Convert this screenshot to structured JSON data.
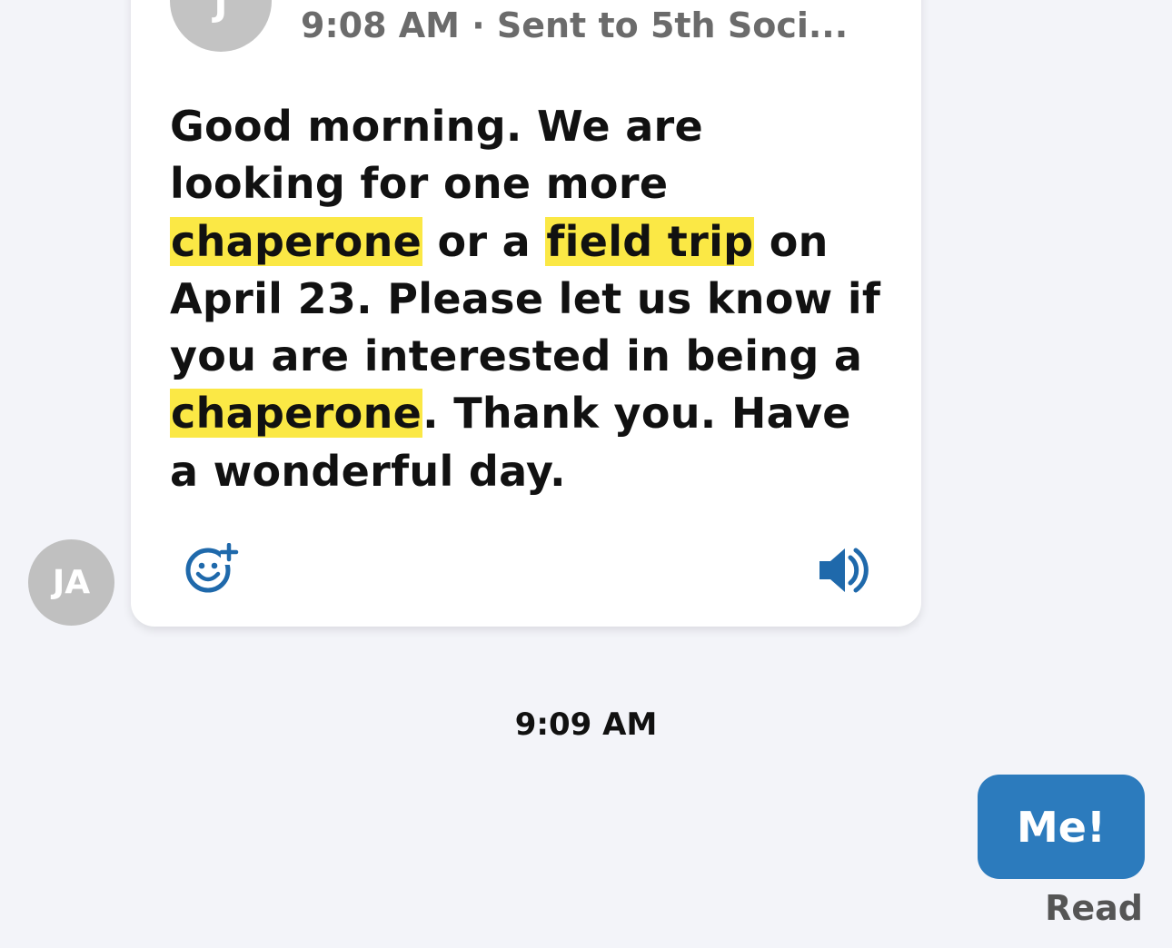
{
  "message": {
    "sender_initial": "J",
    "meta": "9:08 AM · Sent to 5th Soci...",
    "segments": [
      {
        "text": "Good morning. We are looking for one more ",
        "highlight": false
      },
      {
        "text": "chaperone",
        "highlight": true
      },
      {
        "text": " or a ",
        "highlight": false
      },
      {
        "text": "field trip",
        "highlight": true
      },
      {
        "text": " on April 23. Please let us know if you are interested in being a ",
        "highlight": false
      },
      {
        "text": "chaperone",
        "highlight": true
      },
      {
        "text": ". Thank you. Have a wonderful day.",
        "highlight": false
      }
    ],
    "emoji_icon": "add-reaction-icon",
    "speaker_icon": "speaker-icon",
    "highlight_color": "#fbe845"
  },
  "sender_avatar": "JA",
  "timestamp": "9:09 AM",
  "reply": {
    "text": "Me!",
    "status": "Read",
    "color": "#2c7bbd"
  }
}
